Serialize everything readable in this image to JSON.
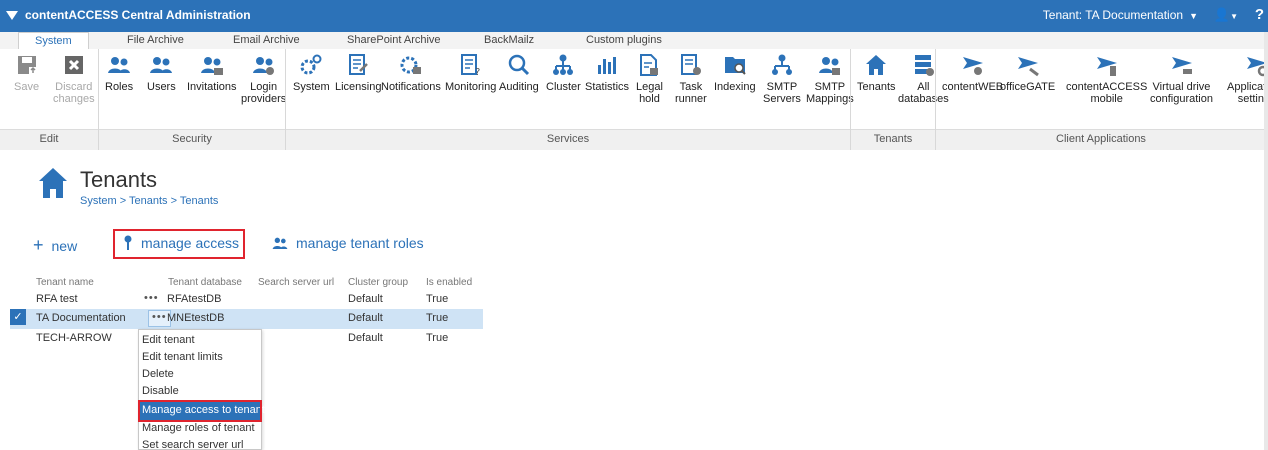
{
  "app": {
    "title": "contentACCESS Central Administration",
    "tenant_label": "Tenant: TA Documentation",
    "help": "?"
  },
  "tabs": [
    "System",
    "File Archive",
    "Email Archive",
    "SharePoint Archive",
    "BackMailz",
    "Custom plugins"
  ],
  "ribbon": {
    "edit": {
      "group": "Edit",
      "save": "Save",
      "discard_1": "Discard",
      "discard_2": "changes"
    },
    "security": {
      "group": "Security",
      "roles": "Roles",
      "users": "Users",
      "invitations": "Invitations",
      "login_1": "Login",
      "login_2": "providers"
    },
    "services": {
      "group": "Services",
      "system": "System",
      "licensing": "Licensing",
      "notifications": "Notifications",
      "monitoring": "Monitoring",
      "auditing": "Auditing",
      "cluster": "Cluster",
      "statistics": "Statistics",
      "legal_1": "Legal",
      "legal_2": "hold",
      "task_1": "Task",
      "task_2": "runner",
      "indexing": "Indexing",
      "smtp_1": "SMTP",
      "smtp_2": "Servers",
      "smtpm_1": "SMTP",
      "smtpm_2": "Mappings"
    },
    "tenants": {
      "group": "Tenants",
      "tenants": "Tenants",
      "all_1": "All",
      "all_2": "databases"
    },
    "client": {
      "group": "Client Applications",
      "contentweb": "contentWEB",
      "officegate": "officeGATE",
      "mobile_1": "contentACCESS",
      "mobile_2": "mobile",
      "vdrive_1": "Virtual drive",
      "vdrive_2": "configuration",
      "apps_1": "Applications",
      "apps_2": "settings"
    }
  },
  "page": {
    "title": "Tenants",
    "breadcrumb": "System > Tenants > Tenants"
  },
  "actions": {
    "new": "new",
    "manage_access": "manage access",
    "manage_roles": "manage tenant roles"
  },
  "table": {
    "headers": [
      "Tenant name",
      "Tenant database",
      "Search server url",
      "Cluster group",
      "Is enabled"
    ],
    "rows": [
      {
        "name": "RFA test",
        "dots": "•••",
        "db": "RFAtestDB",
        "url": "",
        "cluster": "Default",
        "enabled": "True"
      },
      {
        "name": "TA Documentation",
        "dots": "•••",
        "db": "MNEtestDB",
        "url": "",
        "cluster": "Default",
        "enabled": "True"
      },
      {
        "name": "TECH-ARROW",
        "dots": "",
        "db": "",
        "url": "",
        "cluster": "Default",
        "enabled": "True"
      }
    ]
  },
  "context_menu": [
    "Edit tenant",
    "Edit tenant limits",
    "Delete",
    "Disable",
    "Manage access to tenant",
    "Manage roles of tenant",
    "Set search server url"
  ],
  "colors": {
    "accent": "#2c72b8",
    "highlight": "#e0242e",
    "selected_row": "#cfe3f5"
  }
}
